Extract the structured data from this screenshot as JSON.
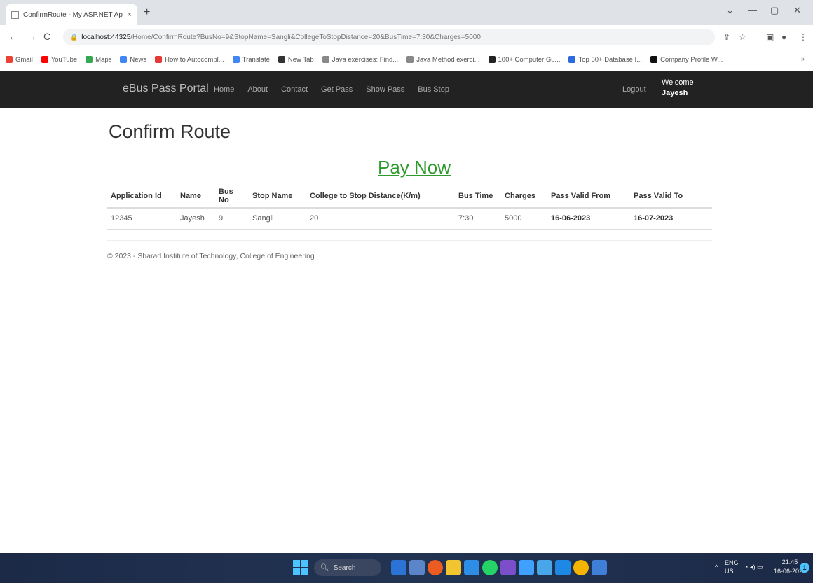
{
  "browser": {
    "tab_title": "ConfirmRoute - My ASP.NET Ap",
    "tab_close": "×",
    "new_tab": "+",
    "url_host": "localhost:44325",
    "url_path": "/Home/ConfirmRoute?BusNo=9&StopName=Sangli&CollegeToStopDistance=20&BusTime=7:30&Charges=5000",
    "window_controls": [
      "⌄",
      "—",
      "▢",
      "✕"
    ]
  },
  "bookmarks": [
    {
      "label": "Gmail",
      "color": "#ea4335"
    },
    {
      "label": "YouTube",
      "color": "#ff0000"
    },
    {
      "label": "Maps",
      "color": "#34a853"
    },
    {
      "label": "News",
      "color": "#4285f4"
    },
    {
      "label": "How to Autocompl...",
      "color": "#e53935"
    },
    {
      "label": "Translate",
      "color": "#4285f4"
    },
    {
      "label": "New Tab",
      "color": "#333333"
    },
    {
      "label": "Java exercises: Find...",
      "color": "#888888"
    },
    {
      "label": "Java Method exerci...",
      "color": "#888888"
    },
    {
      "label": "100+ Computer Gu...",
      "color": "#222222"
    },
    {
      "label": "Top 50+ Database I...",
      "color": "#2d6cdf"
    },
    {
      "label": "Company Profile W...",
      "color": "#111111"
    }
  ],
  "nav": {
    "brand": "eBus Pass Portal",
    "links": [
      "Home",
      "About",
      "Contact",
      "Get Pass",
      "Show Pass",
      "Bus Stop"
    ],
    "logout": "Logout",
    "welcome": "Welcome",
    "user": "Jayesh"
  },
  "page": {
    "title": "Confirm Route",
    "pay_now": "Pay Now",
    "pay_now_color": "#2e9a2e"
  },
  "table": {
    "headers": [
      "Application Id",
      "Name",
      "Bus No",
      "Stop Name",
      "College to Stop Distance(K/m)",
      "Bus Time",
      "Charges",
      "Pass Valid From",
      "Pass Valid To"
    ],
    "rows": [
      [
        "12345",
        "Jayesh",
        "9",
        "Sangli",
        "20",
        "7:30",
        "5000",
        "16-06-2023",
        "16-07-2023"
      ]
    ]
  },
  "footer": "© 2023 - Sharad Institute of Technology, College of Engineering",
  "taskbar": {
    "search_label": "Search",
    "lang": "ENG",
    "region": "US",
    "time": "21:45",
    "date": "16-06-2023",
    "notifications": "1"
  }
}
